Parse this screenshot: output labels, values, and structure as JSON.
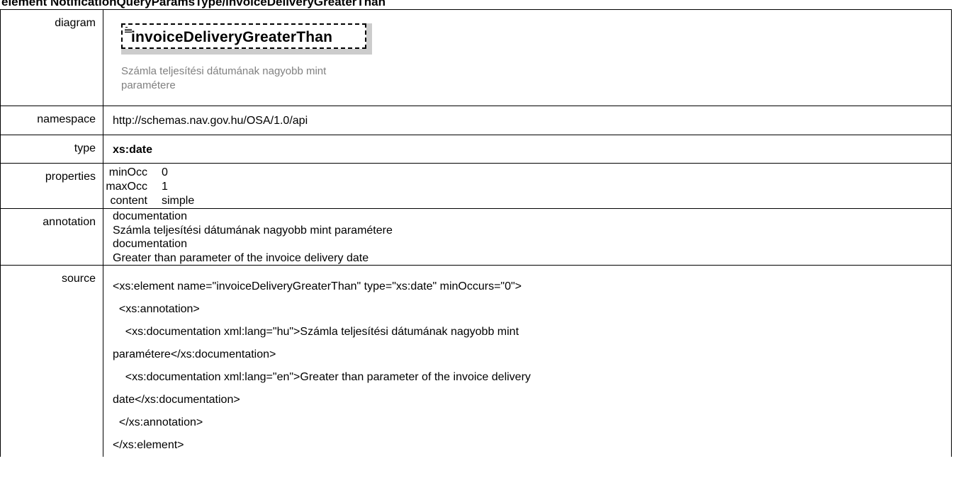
{
  "heading": "element NotificationQueryParamsType/invoiceDeliveryGreaterThan",
  "rows": {
    "diagram": {
      "label": "diagram",
      "element_name": "invoiceDeliveryGreaterThan",
      "element_doc": "Számla teljesítési dátumának nagyobb mint paramétere",
      "icon": "sequence-icon"
    },
    "namespace": {
      "label": "namespace",
      "value": "http://schemas.nav.gov.hu/OSA/1.0/api"
    },
    "type": {
      "label": "type",
      "value": "xs:date"
    },
    "properties": {
      "label": "properties",
      "items": [
        {
          "key": "minOcc",
          "value": "0"
        },
        {
          "key": "maxOcc",
          "value": "1"
        },
        {
          "key": "content",
          "value": "simple"
        }
      ]
    },
    "annotation": {
      "label": "annotation",
      "lines": [
        "documentation",
        "Számla teljesítési dátumának nagyobb mint paramétere",
        "documentation",
        "Greater than parameter of the invoice delivery date"
      ]
    },
    "source": {
      "label": "source",
      "lines": [
        "<xs:element name=\"invoiceDeliveryGreaterThan\" type=\"xs:date\" minOccurs=\"0\">",
        "  <xs:annotation>",
        "    <xs:documentation xml:lang=\"hu\">Számla teljesítési dátumának nagyobb mint",
        "paramétere</xs:documentation>",
        "    <xs:documentation xml:lang=\"en\">Greater than parameter of the invoice delivery",
        "date</xs:documentation>",
        "  </xs:annotation>",
        "</xs:element>"
      ]
    }
  }
}
